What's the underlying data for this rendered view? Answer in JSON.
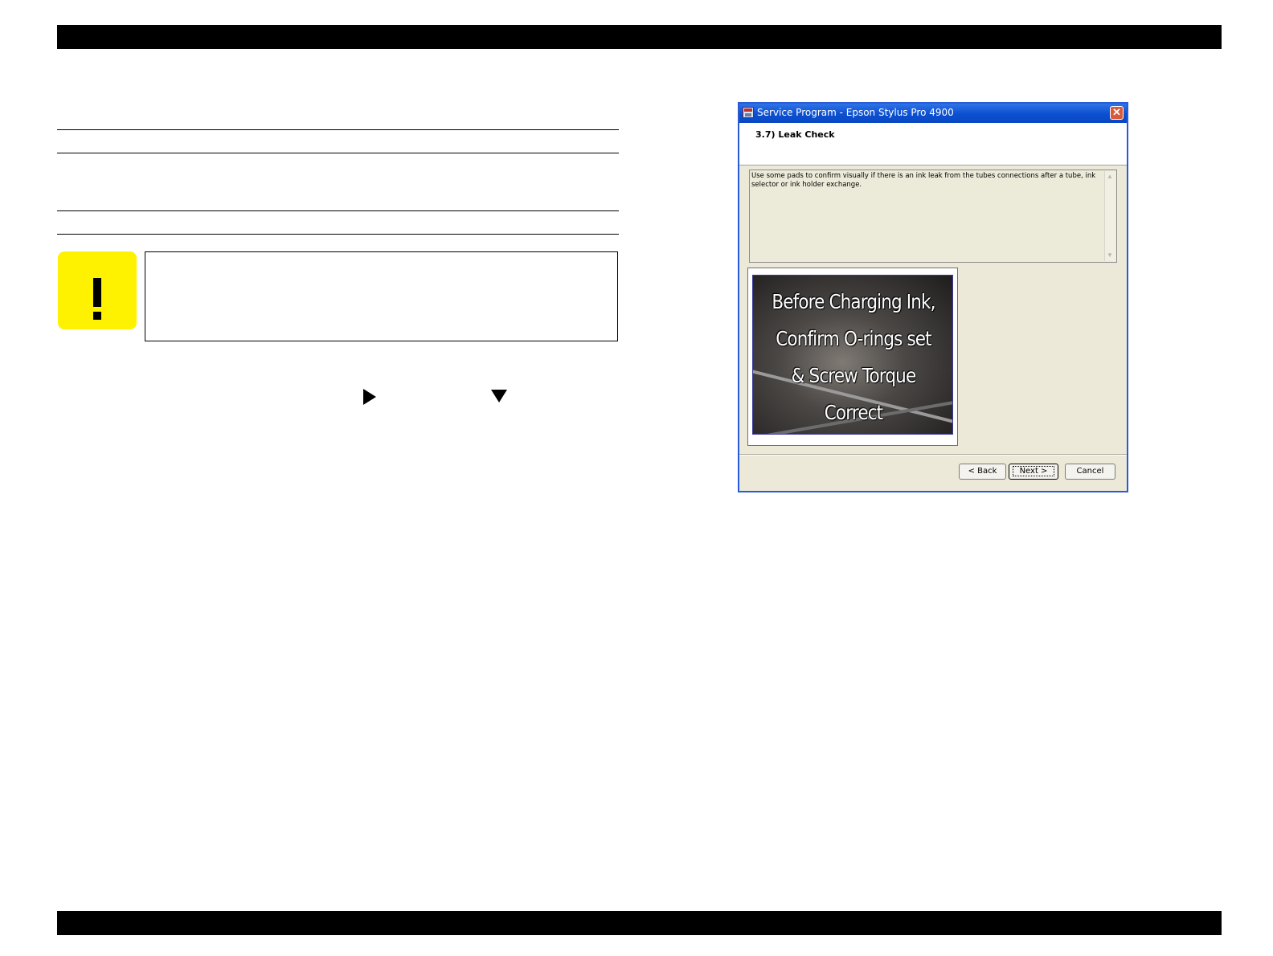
{
  "window": {
    "title": "Service Program - Epson Stylus Pro 4900",
    "close_symbol": "✕",
    "step_title": "3.7) Leak Check",
    "description": "Use some pads to confirm visually if there is an ink leak from the tubes connections after a tube, ink selector or ink holder exchange.",
    "image_text": [
      "Before Charging Ink,",
      "Confirm O-rings set",
      "& Screw Torque Correct"
    ],
    "buttons": {
      "back": "< Back",
      "next": "Next >",
      "cancel": "Cancel"
    }
  },
  "icons": {
    "caution": "exclamation-icon",
    "arrow_right": "right-triangle-icon",
    "arrow_down": "down-triangle-icon",
    "colors": {
      "caution_bg": "#fff200",
      "titlebar": "#0b4fd0"
    }
  }
}
